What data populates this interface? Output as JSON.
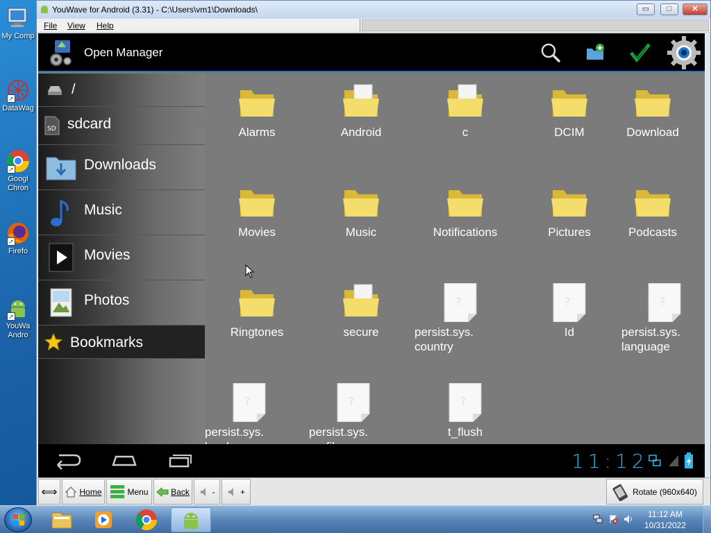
{
  "desktop": {
    "icons": [
      {
        "label": "My Comp",
        "icon": "computer-icon"
      },
      {
        "label": "DataWag",
        "icon": "datawag-icon"
      },
      {
        "label": "Googl Chron",
        "icon": "chrome-icon"
      },
      {
        "label": "Firefo",
        "icon": "firefox-icon"
      },
      {
        "label": "YouWa Andro",
        "icon": "android-icon"
      }
    ]
  },
  "window": {
    "title": "YouWave for Android (3.31) - C:\\Users\\vm1\\Downloads\\",
    "controls": {
      "minimize": "▭",
      "maximize": "□",
      "close": "✕"
    },
    "menu": [
      "File",
      "View",
      "Help"
    ]
  },
  "app": {
    "title": "Open Manager",
    "actions": [
      "search-icon",
      "new-folder-icon",
      "check-icon",
      "settings-icon"
    ],
    "accent": "#2b73c8"
  },
  "sidebar": {
    "items": [
      {
        "label": "/",
        "icon": "drive-icon"
      },
      {
        "label": "sdcard",
        "icon": "sdcard-icon"
      },
      {
        "label": "Downloads",
        "icon": "downloads-icon"
      },
      {
        "label": "Music",
        "icon": "music-icon"
      },
      {
        "label": "Movies",
        "icon": "movies-icon"
      },
      {
        "label": "Photos",
        "icon": "photos-icon"
      },
      {
        "label": "Bookmarks",
        "icon": "star-icon"
      }
    ]
  },
  "files": [
    {
      "label": "Alarms",
      "type": "folder"
    },
    {
      "label": "Android",
      "type": "folder-docs"
    },
    {
      "label": "c",
      "type": "folder-docs"
    },
    {
      "label": "DCIM",
      "type": "folder"
    },
    {
      "label": "Download",
      "type": "folder"
    },
    {
      "label": "Movies",
      "type": "folder"
    },
    {
      "label": "Music",
      "type": "folder"
    },
    {
      "label": "Notifications",
      "type": "folder"
    },
    {
      "label": "Pictures",
      "type": "folder"
    },
    {
      "label": "Podcasts",
      "type": "folder"
    },
    {
      "label": "Ringtones",
      "type": "folder"
    },
    {
      "label": "secure",
      "type": "folder-docs"
    },
    {
      "label": "persist.sys. country",
      "type": "file"
    },
    {
      "label": "Id",
      "type": "file"
    },
    {
      "label": "persist.sys. language",
      "type": "file"
    },
    {
      "label": "persist.sys. localevar",
      "type": "file"
    },
    {
      "label": "persist.sys. profiler_ms",
      "type": "file"
    },
    {
      "label": "t_flush",
      "type": "file"
    }
  ],
  "statusbar": {
    "clock": "11:12"
  },
  "toolbar": {
    "home": "Home",
    "menu": "Menu",
    "back": "Back",
    "vol_down": "-",
    "vol_up": "+",
    "rotate": "Rotate (960x640)"
  },
  "taskbar": {
    "time": "11:12 AM",
    "date": "10/31/2022"
  }
}
